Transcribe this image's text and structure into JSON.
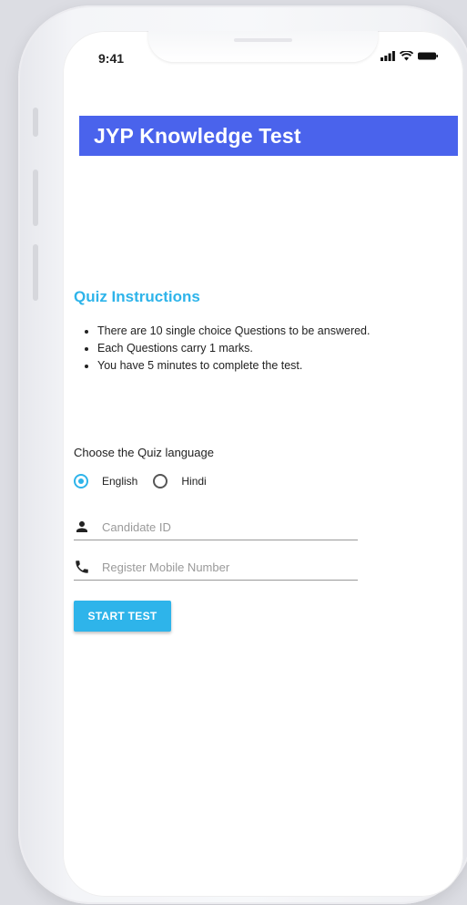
{
  "status_bar": {
    "time": "9:41",
    "icons": [
      "cellular-signal-icon",
      "wifi-icon",
      "battery-icon"
    ]
  },
  "app": {
    "title": "JYP Knowledge Test"
  },
  "instructions": {
    "heading": "Quiz Instructions",
    "items": [
      "There are 10 single choice Questions to be answered.",
      "Each Questions carry 1 marks.",
      "You have 5 minutes to complete the test."
    ]
  },
  "language": {
    "label": "Choose the Quiz language",
    "options": [
      {
        "label": "English",
        "selected": true
      },
      {
        "label": "Hindi",
        "selected": false
      }
    ]
  },
  "form": {
    "candidate_id": {
      "placeholder": "Candidate ID",
      "value": "",
      "icon": "person-icon"
    },
    "mobile": {
      "placeholder": "Register Mobile Number",
      "value": "",
      "icon": "phone-icon"
    }
  },
  "actions": {
    "start_label": "START TEST"
  },
  "colors": {
    "title_bar": "#4a63ec",
    "accent": "#2eb4ea"
  }
}
